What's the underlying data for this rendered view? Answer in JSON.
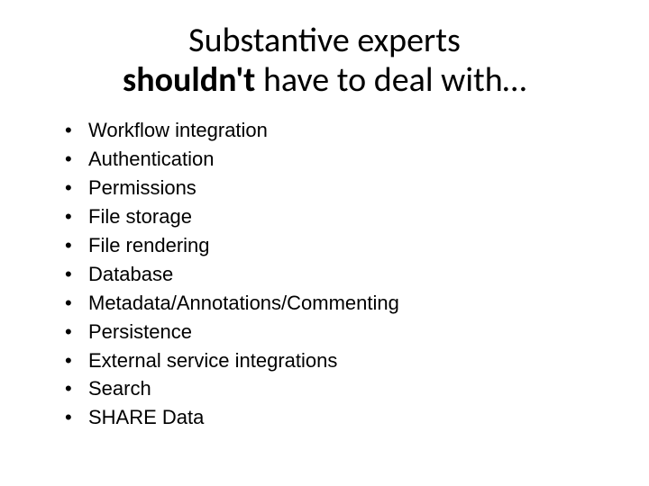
{
  "title": {
    "line1_normal": "Substantive experts",
    "line2_bold": "shouldn't",
    "line2_normal": " have to deal with…"
  },
  "bullets": [
    "Workflow integration",
    "Authentication",
    "Permissions",
    "File storage",
    "File rendering",
    "Database",
    "Metadata/Annotations/Commenting",
    "Persistence",
    "External service integrations",
    "Search",
    "SHARE Data"
  ]
}
